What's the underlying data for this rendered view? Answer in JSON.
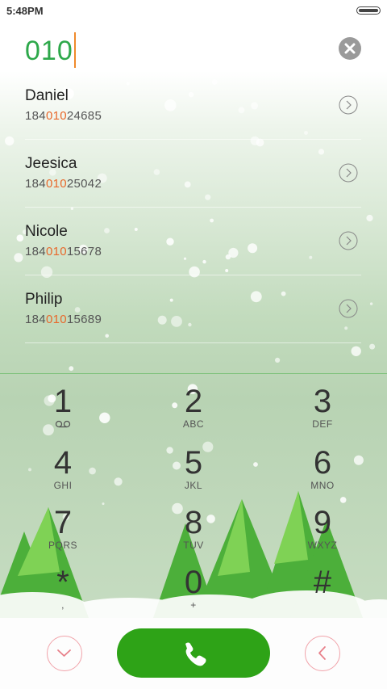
{
  "status": {
    "time": "5:48PM"
  },
  "dial": {
    "digits": "010"
  },
  "contacts": [
    {
      "name": "Daniel",
      "pre": "184",
      "match": "010",
      "post": "24685"
    },
    {
      "name": "Jeesica",
      "pre": "184",
      "match": "010",
      "post": "25042"
    },
    {
      "name": "Nicole",
      "pre": "184",
      "match": "010",
      "post": "15678"
    },
    {
      "name": "Philip",
      "pre": "184",
      "match": "010",
      "post": "15689"
    }
  ],
  "keypad": [
    {
      "digit": "1",
      "letters": "",
      "icon": "voicemail-icon"
    },
    {
      "digit": "2",
      "letters": "ABC"
    },
    {
      "digit": "3",
      "letters": "DEF"
    },
    {
      "digit": "4",
      "letters": "GHI"
    },
    {
      "digit": "5",
      "letters": "JKL"
    },
    {
      "digit": "6",
      "letters": "MNO"
    },
    {
      "digit": "7",
      "letters": "PQRS"
    },
    {
      "digit": "8",
      "letters": "TUV"
    },
    {
      "digit": "9",
      "letters": "WXYZ"
    },
    {
      "digit": "*",
      "letters": ","
    },
    {
      "digit": "0",
      "letters": "+"
    },
    {
      "digit": "#",
      "letters": ""
    }
  ],
  "colors": {
    "accent": "#2da84a",
    "highlight": "#e8682b",
    "call": "#2ea317",
    "outline": "#f1a3aa"
  },
  "icons": {
    "clear": "clear-icon",
    "contact_arrow": "chevron-right-icon",
    "collapse": "chevron-down-icon",
    "call": "phone-icon",
    "backspace": "chevron-left-icon"
  }
}
